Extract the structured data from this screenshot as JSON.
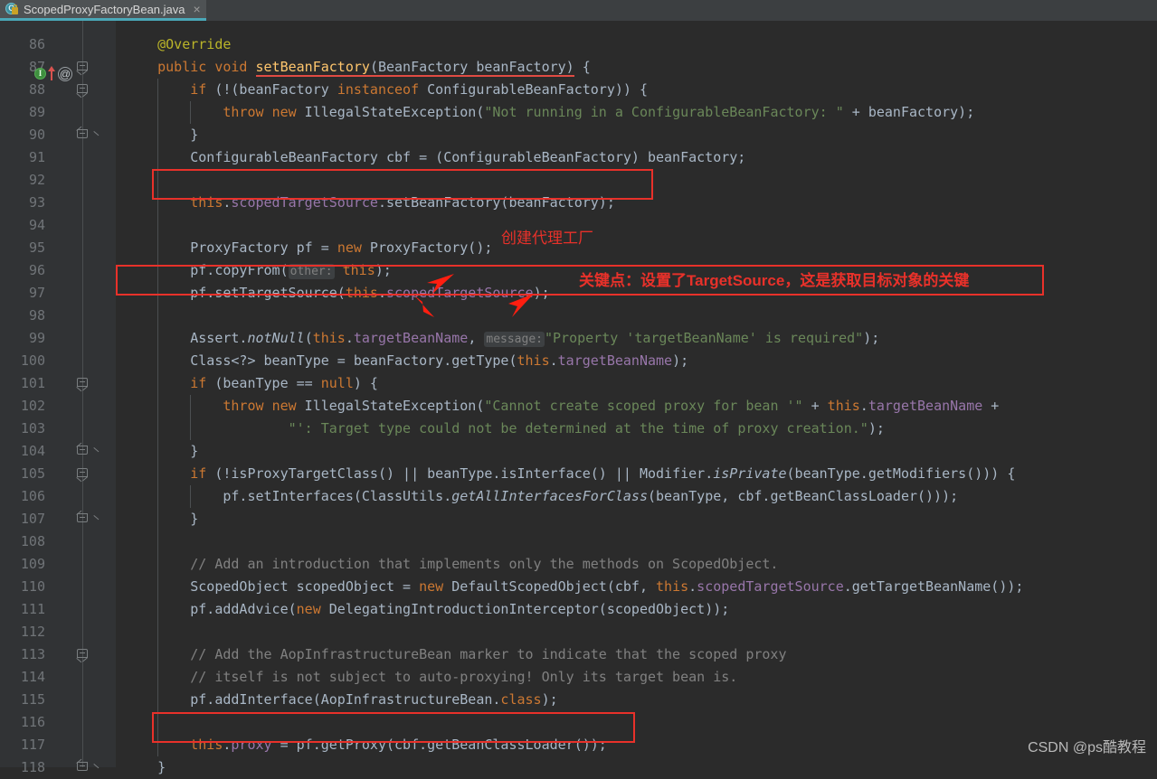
{
  "window": {
    "tab": {
      "title": "ScopedProxyFactoryBean.java",
      "close_label": "×",
      "icon_letter": "C",
      "accent_color": "#4aa8b8"
    }
  },
  "gutter": {
    "first_line": 86,
    "last_line": 118,
    "line_numbers": [
      86,
      87,
      88,
      89,
      90,
      91,
      92,
      93,
      94,
      95,
      96,
      97,
      98,
      99,
      100,
      101,
      102,
      103,
      104,
      105,
      106,
      107,
      108,
      109,
      110,
      111,
      112,
      113,
      114,
      115,
      116,
      117,
      118
    ],
    "markers": {
      "implementing_method_letter": "I",
      "annotation_glyph": "@"
    }
  },
  "editor": {
    "language": "java",
    "theme": "darcula",
    "background": "#2b2b2b",
    "gutter_background": "#313335",
    "lines": [
      {
        "n": 86,
        "indent": 0,
        "segments": [
          {
            "t": "    ",
            "c": "def"
          },
          {
            "t": "@Override",
            "c": "ann"
          }
        ]
      },
      {
        "n": 87,
        "indent": 0,
        "segments": [
          {
            "t": "    ",
            "c": "def"
          },
          {
            "t": "public",
            "c": "kw"
          },
          {
            "t": " ",
            "c": "def"
          },
          {
            "t": "void",
            "c": "kw"
          },
          {
            "t": " ",
            "c": "def"
          },
          {
            "t": "setBeanFactory",
            "c": "ulmethod"
          },
          {
            "t": "(BeanFactory beanFactory)",
            "c": "ulplain"
          },
          {
            "t": " {",
            "c": "def"
          }
        ]
      },
      {
        "n": 88,
        "indent": 0,
        "segments": [
          {
            "t": "        ",
            "c": "def"
          },
          {
            "t": "if",
            "c": "kw"
          },
          {
            "t": " (!(beanFactory ",
            "c": "def"
          },
          {
            "t": "instanceof",
            "c": "kw"
          },
          {
            "t": " ConfigurableBeanFactory)) {",
            "c": "def"
          }
        ]
      },
      {
        "n": 89,
        "indent": 0,
        "segments": [
          {
            "t": "            ",
            "c": "def"
          },
          {
            "t": "throw",
            "c": "kw"
          },
          {
            "t": " ",
            "c": "def"
          },
          {
            "t": "new",
            "c": "kw"
          },
          {
            "t": " IllegalStateException(",
            "c": "def"
          },
          {
            "t": "\"Not running in a ConfigurableBeanFactory: \"",
            "c": "str"
          },
          {
            "t": " + beanFactory);",
            "c": "def"
          }
        ]
      },
      {
        "n": 90,
        "indent": 0,
        "segments": [
          {
            "t": "        }",
            "c": "def"
          }
        ]
      },
      {
        "n": 91,
        "indent": 0,
        "segments": [
          {
            "t": "        ConfigurableBeanFactory cbf = (ConfigurableBeanFactory) beanFactory;",
            "c": "def"
          }
        ]
      },
      {
        "n": 92,
        "indent": 0,
        "segments": []
      },
      {
        "n": 93,
        "indent": 0,
        "segments": [
          {
            "t": "        ",
            "c": "def"
          },
          {
            "t": "this",
            "c": "kw"
          },
          {
            "t": ".",
            "c": "def"
          },
          {
            "t": "scopedTargetSource",
            "c": "fld"
          },
          {
            "t": ".setBeanFactory(beanFactory);",
            "c": "def"
          }
        ]
      },
      {
        "n": 94,
        "indent": 0,
        "segments": []
      },
      {
        "n": 95,
        "indent": 0,
        "segments": [
          {
            "t": "        ProxyFactory pf = ",
            "c": "def"
          },
          {
            "t": "new",
            "c": "kw"
          },
          {
            "t": " ProxyFactory();",
            "c": "def"
          }
        ]
      },
      {
        "n": 96,
        "indent": 0,
        "segments": [
          {
            "t": "        pf.copyFrom(",
            "c": "def"
          },
          {
            "t": "HINT:other:",
            "c": "hint"
          },
          {
            "t": " ",
            "c": "def"
          },
          {
            "t": "this",
            "c": "kw"
          },
          {
            "t": ");",
            "c": "def"
          }
        ]
      },
      {
        "n": 97,
        "indent": 0,
        "segments": [
          {
            "t": "        pf.setTargetSource(",
            "c": "def"
          },
          {
            "t": "this",
            "c": "kw"
          },
          {
            "t": ".",
            "c": "def"
          },
          {
            "t": "scopedTargetSource",
            "c": "fld"
          },
          {
            "t": ");",
            "c": "def"
          }
        ]
      },
      {
        "n": 98,
        "indent": 0,
        "segments": []
      },
      {
        "n": 99,
        "indent": 0,
        "segments": [
          {
            "t": "        Assert.",
            "c": "def"
          },
          {
            "t": "notNull",
            "c": "ital"
          },
          {
            "t": "(",
            "c": "def"
          },
          {
            "t": "this",
            "c": "kw"
          },
          {
            "t": ".",
            "c": "def"
          },
          {
            "t": "targetBeanName",
            "c": "fld"
          },
          {
            "t": ", ",
            "c": "def"
          },
          {
            "t": "HINT:message:",
            "c": "hint"
          },
          {
            "t": "\"Property 'targetBeanName' is required\"",
            "c": "str"
          },
          {
            "t": ");",
            "c": "def"
          }
        ]
      },
      {
        "n": 100,
        "indent": 0,
        "segments": [
          {
            "t": "        Class<?> beanType = beanFactory.getType(",
            "c": "def"
          },
          {
            "t": "this",
            "c": "kw"
          },
          {
            "t": ".",
            "c": "def"
          },
          {
            "t": "targetBeanName",
            "c": "fld"
          },
          {
            "t": ");",
            "c": "def"
          }
        ]
      },
      {
        "n": 101,
        "indent": 0,
        "segments": [
          {
            "t": "        ",
            "c": "def"
          },
          {
            "t": "if",
            "c": "kw"
          },
          {
            "t": " (beanType == ",
            "c": "def"
          },
          {
            "t": "null",
            "c": "kw"
          },
          {
            "t": ") {",
            "c": "def"
          }
        ]
      },
      {
        "n": 102,
        "indent": 0,
        "segments": [
          {
            "t": "            ",
            "c": "def"
          },
          {
            "t": "throw",
            "c": "kw"
          },
          {
            "t": " ",
            "c": "def"
          },
          {
            "t": "new",
            "c": "kw"
          },
          {
            "t": " IllegalStateException(",
            "c": "def"
          },
          {
            "t": "\"Cannot create scoped proxy for bean '\"",
            "c": "str"
          },
          {
            "t": " + ",
            "c": "def"
          },
          {
            "t": "this",
            "c": "kw"
          },
          {
            "t": ".",
            "c": "def"
          },
          {
            "t": "targetBeanName",
            "c": "fld"
          },
          {
            "t": " +",
            "c": "def"
          }
        ]
      },
      {
        "n": 103,
        "indent": 0,
        "segments": [
          {
            "t": "                    ",
            "c": "def"
          },
          {
            "t": "\"': Target type could not be determined at the time of proxy creation.\"",
            "c": "str"
          },
          {
            "t": ");",
            "c": "def"
          }
        ]
      },
      {
        "n": 104,
        "indent": 0,
        "segments": [
          {
            "t": "        }",
            "c": "def"
          }
        ]
      },
      {
        "n": 105,
        "indent": 0,
        "segments": [
          {
            "t": "        ",
            "c": "def"
          },
          {
            "t": "if",
            "c": "kw"
          },
          {
            "t": " (!isProxyTargetClass() || beanType.isInterface() || Modifier.",
            "c": "def"
          },
          {
            "t": "isPrivate",
            "c": "ital"
          },
          {
            "t": "(beanType.getModifiers())) {",
            "c": "def"
          }
        ]
      },
      {
        "n": 106,
        "indent": 0,
        "segments": [
          {
            "t": "            pf.setInterfaces(ClassUtils.",
            "c": "def"
          },
          {
            "t": "getAllInterfacesForClass",
            "c": "ital"
          },
          {
            "t": "(beanType, cbf.getBeanClassLoader()));",
            "c": "def"
          }
        ]
      },
      {
        "n": 107,
        "indent": 0,
        "segments": [
          {
            "t": "        }",
            "c": "def"
          }
        ]
      },
      {
        "n": 108,
        "indent": 0,
        "segments": []
      },
      {
        "n": 109,
        "indent": 0,
        "segments": [
          {
            "t": "        // Add an introduction that implements only the methods on ScopedObject.",
            "c": "cmt"
          }
        ]
      },
      {
        "n": 110,
        "indent": 0,
        "segments": [
          {
            "t": "        ScopedObject scopedObject = ",
            "c": "def"
          },
          {
            "t": "new",
            "c": "kw"
          },
          {
            "t": " DefaultScopedObject(cbf, ",
            "c": "def"
          },
          {
            "t": "this",
            "c": "kw"
          },
          {
            "t": ".",
            "c": "def"
          },
          {
            "t": "scopedTargetSource",
            "c": "fld"
          },
          {
            "t": ".getTargetBeanName());",
            "c": "def"
          }
        ]
      },
      {
        "n": 111,
        "indent": 0,
        "segments": [
          {
            "t": "        pf.addAdvice(",
            "c": "def"
          },
          {
            "t": "new",
            "c": "kw"
          },
          {
            "t": " DelegatingIntroductionInterceptor(scopedObject));",
            "c": "def"
          }
        ]
      },
      {
        "n": 112,
        "indent": 0,
        "segments": []
      },
      {
        "n": 113,
        "indent": 0,
        "segments": [
          {
            "t": "        // Add the AopInfrastructureBean marker to indicate that the scoped proxy",
            "c": "cmt"
          }
        ]
      },
      {
        "n": 114,
        "indent": 0,
        "segments": [
          {
            "t": "        // itself is not subject to auto-proxying! Only its target bean is.",
            "c": "cmt"
          }
        ]
      },
      {
        "n": 115,
        "indent": 0,
        "segments": [
          {
            "t": "        pf.addInterface(AopInfrastructureBean.",
            "c": "def"
          },
          {
            "t": "class",
            "c": "kw"
          },
          {
            "t": ");",
            "c": "def"
          }
        ]
      },
      {
        "n": 116,
        "indent": 0,
        "segments": []
      },
      {
        "n": 117,
        "indent": 0,
        "segments": [
          {
            "t": "        ",
            "c": "def"
          },
          {
            "t": "this",
            "c": "kw"
          },
          {
            "t": ".",
            "c": "def"
          },
          {
            "t": "proxy",
            "c": "fld"
          },
          {
            "t": " = pf.getProxy(cbf.getBeanClassLoader());",
            "c": "def"
          }
        ]
      },
      {
        "n": 118,
        "indent": 0,
        "segments": [
          {
            "t": "    }",
            "c": "def"
          }
        ]
      }
    ],
    "parameter_hints": {
      "line_96": "other:",
      "line_99": "message:"
    }
  },
  "annotations": {
    "color": "#e8312a",
    "comments": [
      {
        "id": "create-proxy-factory",
        "text": "创建代理工厂",
        "line": 95
      },
      {
        "id": "key-point",
        "text": "关键点：设置了TargetSource，这是获取目标对象的关键",
        "line": 97
      }
    ],
    "highlight_boxes": [
      {
        "id": "box-set-bean-factory",
        "line": 93
      },
      {
        "id": "box-set-target-source",
        "line": 97
      },
      {
        "id": "box-get-proxy",
        "line": 117
      }
    ],
    "arrow_count": 3,
    "arrow_target": "scopedTargetSource"
  },
  "watermark": {
    "text": "CSDN @ps酷教程"
  }
}
